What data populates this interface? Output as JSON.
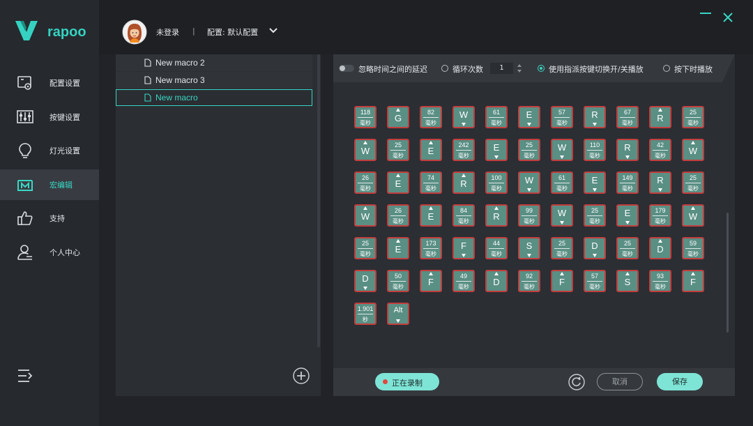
{
  "sidebar": {
    "logo_text": "rapoo",
    "items": [
      {
        "label": "配置设置",
        "icon": "config-icon"
      },
      {
        "label": "按键设置",
        "icon": "sliders-icon"
      },
      {
        "label": "灯光设置",
        "icon": "bulb-icon"
      },
      {
        "label": "宏编辑",
        "icon": "macro-icon",
        "active": true
      },
      {
        "label": "支持",
        "icon": "thumbs-up-icon"
      },
      {
        "label": "个人中心",
        "icon": "user-icon"
      }
    ]
  },
  "header": {
    "login_status": "未登录",
    "separator": "|",
    "profile": "配置: 默认配置"
  },
  "macros": {
    "items": [
      {
        "name": "New macro 2"
      },
      {
        "name": "New macro 3"
      },
      {
        "name": "New macro",
        "selected": true
      }
    ]
  },
  "toolbar": {
    "ignore_delay_label": "忽略时间之间的延迟",
    "loop_label": "循环次数",
    "loop_value": "1",
    "toggle_play_label": "使用指派按键切换开/关播放",
    "hold_play_label": "按下时播放",
    "selected_mode": "toggle"
  },
  "steps": [
    {
      "t": "d",
      "v": "118",
      "u": "毫秒"
    },
    {
      "t": "k",
      "k": "G",
      "dir": "up"
    },
    {
      "t": "d",
      "v": "82",
      "u": "毫秒"
    },
    {
      "t": "k",
      "k": "W",
      "dir": "down"
    },
    {
      "t": "d",
      "v": "61",
      "u": "毫秒"
    },
    {
      "t": "k",
      "k": "E",
      "dir": "down"
    },
    {
      "t": "d",
      "v": "57",
      "u": "毫秒"
    },
    {
      "t": "k",
      "k": "R",
      "dir": "down"
    },
    {
      "t": "d",
      "v": "67",
      "u": "毫秒"
    },
    {
      "t": "k",
      "k": "R",
      "dir": "up"
    },
    {
      "t": "d",
      "v": "25",
      "u": "毫秒"
    },
    {
      "t": "k",
      "k": "W",
      "dir": "up"
    },
    {
      "t": "d",
      "v": "25",
      "u": "毫秒"
    },
    {
      "t": "k",
      "k": "E",
      "dir": "up"
    },
    {
      "t": "d",
      "v": "242",
      "u": "毫秒"
    },
    {
      "t": "k",
      "k": "E",
      "dir": "down"
    },
    {
      "t": "d",
      "v": "25",
      "u": "毫秒"
    },
    {
      "t": "k",
      "k": "W",
      "dir": "down"
    },
    {
      "t": "d",
      "v": "110",
      "u": "毫秒"
    },
    {
      "t": "k",
      "k": "R",
      "dir": "down"
    },
    {
      "t": "d",
      "v": "42",
      "u": "毫秒"
    },
    {
      "t": "k",
      "k": "W",
      "dir": "up"
    },
    {
      "t": "d",
      "v": "26",
      "u": "毫秒"
    },
    {
      "t": "k",
      "k": "E",
      "dir": "up"
    },
    {
      "t": "d",
      "v": "74",
      "u": "毫秒"
    },
    {
      "t": "k",
      "k": "R",
      "dir": "up"
    },
    {
      "t": "d",
      "v": "100",
      "u": "毫秒"
    },
    {
      "t": "k",
      "k": "W",
      "dir": "down"
    },
    {
      "t": "d",
      "v": "61",
      "u": "毫秒"
    },
    {
      "t": "k",
      "k": "E",
      "dir": "down"
    },
    {
      "t": "d",
      "v": "149",
      "u": "毫秒"
    },
    {
      "t": "k",
      "k": "R",
      "dir": "down"
    },
    {
      "t": "d",
      "v": "25",
      "u": "毫秒"
    },
    {
      "t": "k",
      "k": "W",
      "dir": "up"
    },
    {
      "t": "d",
      "v": "26",
      "u": "毫秒"
    },
    {
      "t": "k",
      "k": "E",
      "dir": "up"
    },
    {
      "t": "d",
      "v": "84",
      "u": "毫秒"
    },
    {
      "t": "k",
      "k": "R",
      "dir": "up"
    },
    {
      "t": "d",
      "v": "99",
      "u": "毫秒"
    },
    {
      "t": "k",
      "k": "W",
      "dir": "down"
    },
    {
      "t": "d",
      "v": "25",
      "u": "毫秒"
    },
    {
      "t": "k",
      "k": "E",
      "dir": "down"
    },
    {
      "t": "d",
      "v": "179",
      "u": "毫秒"
    },
    {
      "t": "k",
      "k": "W",
      "dir": "up"
    },
    {
      "t": "d",
      "v": "25",
      "u": "毫秒"
    },
    {
      "t": "k",
      "k": "E",
      "dir": "up"
    },
    {
      "t": "d",
      "v": "173",
      "u": "毫秒"
    },
    {
      "t": "k",
      "k": "F",
      "dir": "down"
    },
    {
      "t": "d",
      "v": "44",
      "u": "毫秒"
    },
    {
      "t": "k",
      "k": "S",
      "dir": "down"
    },
    {
      "t": "d",
      "v": "25",
      "u": "毫秒"
    },
    {
      "t": "k",
      "k": "D",
      "dir": "down"
    },
    {
      "t": "d",
      "v": "25",
      "u": "毫秒"
    },
    {
      "t": "k",
      "k": "D",
      "dir": "up"
    },
    {
      "t": "d",
      "v": "59",
      "u": "毫秒"
    },
    {
      "t": "k",
      "k": "D",
      "dir": "down"
    },
    {
      "t": "d",
      "v": "50",
      "u": "毫秒"
    },
    {
      "t": "k",
      "k": "F",
      "dir": "up"
    },
    {
      "t": "d",
      "v": "49",
      "u": "毫秒"
    },
    {
      "t": "k",
      "k": "D",
      "dir": "up"
    },
    {
      "t": "d",
      "v": "92",
      "u": "毫秒"
    },
    {
      "t": "k",
      "k": "F",
      "dir": "up"
    },
    {
      "t": "d",
      "v": "57",
      "u": "毫秒"
    },
    {
      "t": "k",
      "k": "S",
      "dir": "up"
    },
    {
      "t": "d",
      "v": "93",
      "u": "毫秒"
    },
    {
      "t": "k",
      "k": "F",
      "dir": "up"
    },
    {
      "t": "d",
      "v": "1.901",
      "u": "秒"
    },
    {
      "t": "k",
      "k": "Alt",
      "dir": "down"
    }
  ],
  "footer": {
    "record_label": "正在录制",
    "cancel_label": "取消",
    "save_label": "保存"
  },
  "colors": {
    "accent": "#3ad6c3",
    "step_fill": "#5a8f84",
    "step_border": "#c33d3d",
    "recording_dot": "#e0473f"
  }
}
